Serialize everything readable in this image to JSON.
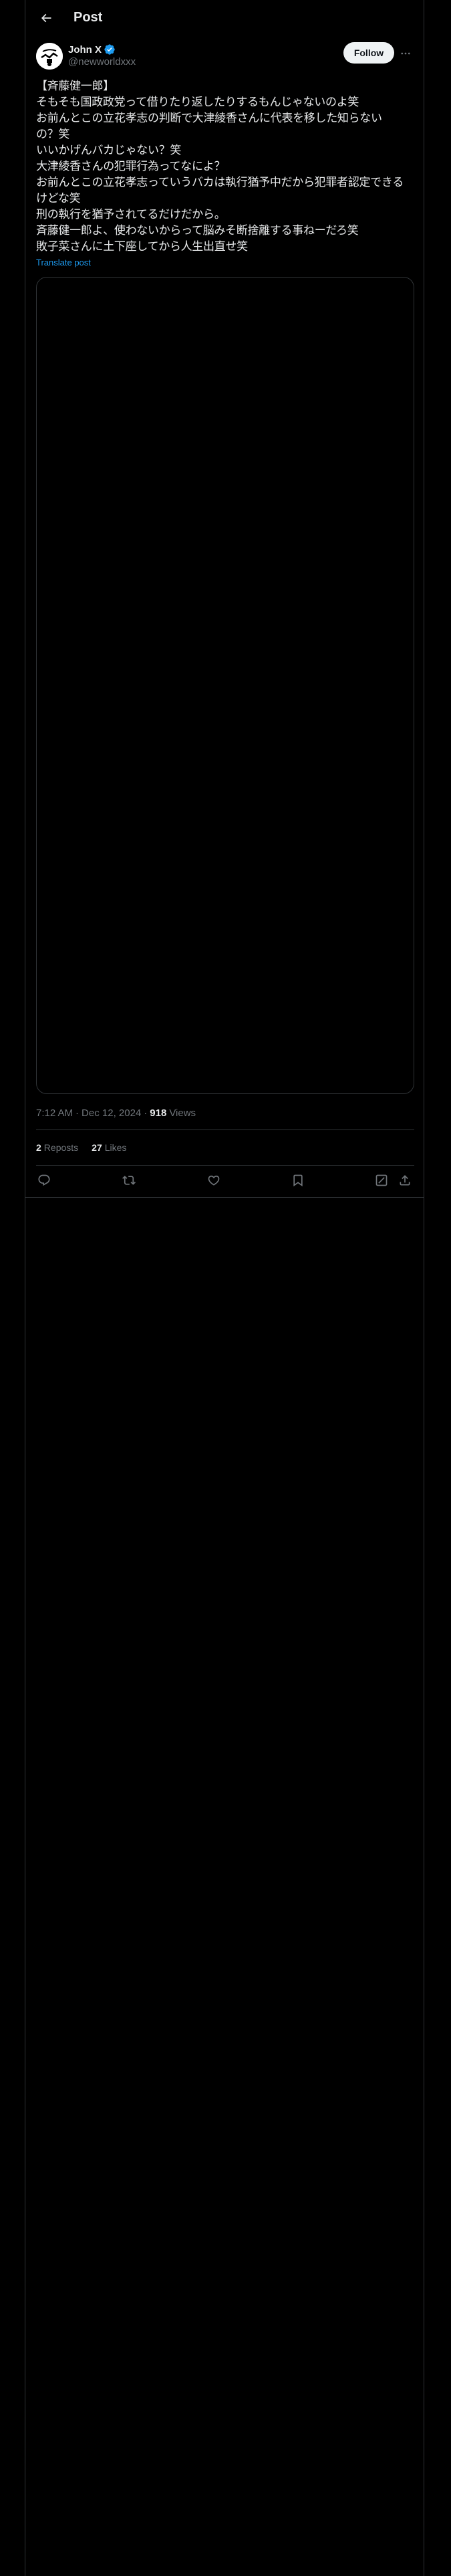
{
  "header": {
    "title": "Post",
    "back_icon": "arrow-left-icon"
  },
  "author": {
    "name": "John X",
    "handle": "@newworldxxx",
    "verified_color": "#1d9bf0",
    "follow_label": "Follow",
    "more_icon": "more-dots-icon"
  },
  "tweet": {
    "lines": [
      "【斉藤健一郎】",
      "そもそも国政政党って借りたり返したりするもんじゃないのよ笑",
      "お前んとこの立花孝志の判断で大津綾香さんに代表を移した知らない",
      "の？笑",
      "いいかげんバカじゃない？笑",
      "大津綾香さんの犯罪行為ってなによ？",
      "お前んとこの立花孝志っていうバカは執行猶予中だから犯罪者認定できる",
      "けどな笑",
      "刑の執行を猶予されてるだけだから。",
      "斉藤健一郎よ、使わないからって脳みそ断捨離する事ねーだろ笑",
      "敗子菜さんに土下座してから人生出直せ笑"
    ],
    "translate_label": "Translate post"
  },
  "meta": {
    "time": "7:12 AM",
    "separator": "·",
    "date": "Dec 12, 2024",
    "views_count": "918",
    "views_label": "Views"
  },
  "stats": {
    "reposts_count": "2",
    "reposts_label": "Reposts",
    "likes_count": "27",
    "likes_label": "Likes"
  },
  "actions": {
    "reply_icon": "reply-icon",
    "repost_icon": "repost-icon",
    "like_icon": "heart-icon",
    "bookmark_icon": "bookmark-icon",
    "grok_icon": "grok-icon",
    "share_icon": "share-icon"
  },
  "colors": {
    "background": "#000000",
    "text": "#e7e9ea",
    "secondary": "#71767b",
    "accent": "#1d9bf0",
    "border": "#2f3336"
  }
}
